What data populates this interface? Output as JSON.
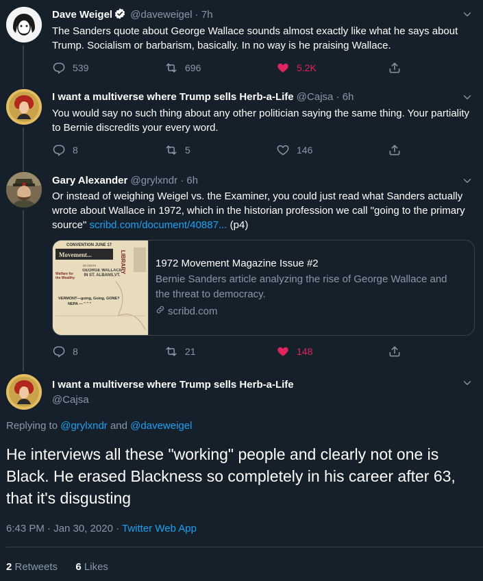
{
  "colors": {
    "background": "#15202b",
    "text": "#ffffff",
    "muted": "#8899a6",
    "link": "#1da1f2",
    "like": "#e0245e",
    "border": "#38444d"
  },
  "tweets": [
    {
      "name": "Dave Weigel",
      "verified": true,
      "handle": "@daveweigel",
      "time": "· 7h",
      "text": "The Sanders quote about George Wallace sounds almost exactly like what he says about Trump. Socialism or barbarism, basically. In no way is he praising Wallace.",
      "replies": "539",
      "retweets": "696",
      "likes": "5.2K",
      "liked": true
    },
    {
      "name": "I want a multiverse where Trump sells Herb-a-Life",
      "handle": "@Cajsa",
      "time": "· 6h",
      "text": "You would say no such thing about any other politician saying the same thing. Your partiality to Bernie discredits your every word.",
      "replies": "8",
      "retweets": "5",
      "likes": "146",
      "liked": false
    },
    {
      "name": "Gary Alexander",
      "handle": "@grylxndr",
      "time": "· 6h",
      "text": "Or instead of weighing Weigel vs. the Examiner, you could just read what Sanders actually wrote about Wallace in 1972, which in the historian profession we call \"going to the primary source\" ",
      "link": "scribd.com/document/40887...",
      "suffix": " (p4)",
      "card": {
        "title": "1972 Movement Magazine Issue #2",
        "description": "Bernie Sanders article analyzing the rise of George Wallace and the threat to democracy.",
        "domain": "scribd.com",
        "thumb": {
          "top": "CONVENTION JUNE 17",
          "banner": "Movement...",
          "side": "LIBRARY",
          "price": "25 CENTS",
          "headline": "GEORGE WALLACE IN ST. ALBANS,VT.",
          "left": "Welfare for the Wealthy",
          "bottom1": "VERMONT—going, Going, GONE?",
          "bottom2": "NEPA —  \"    \"    \""
        }
      },
      "replies": "8",
      "retweets": "21",
      "likes": "148",
      "liked": true
    }
  ],
  "main": {
    "name": "I want a multiverse where Trump sells Herb-a-Life",
    "handle": "@Cajsa",
    "replying_prefix": "Replying to ",
    "replying_to_1": "@grylxndr",
    "replying_and": " and ",
    "replying_to_2": "@daveweigel",
    "text": "He interviews all these \"working\" people and clearly not one is Black. He erased Blackness so completely in his career after 63, that it's disgusting",
    "timestamp": "6:43 PM · Jan 30, 2020 · ",
    "source": "Twitter Web App",
    "retweet_count": "2",
    "retweet_label": " Retweets",
    "like_count": "6",
    "like_label": " Likes"
  },
  "icons": [
    "verified-icon",
    "chevron-down-icon",
    "reply-icon",
    "retweet-icon",
    "heart-icon",
    "share-icon",
    "link-icon"
  ]
}
